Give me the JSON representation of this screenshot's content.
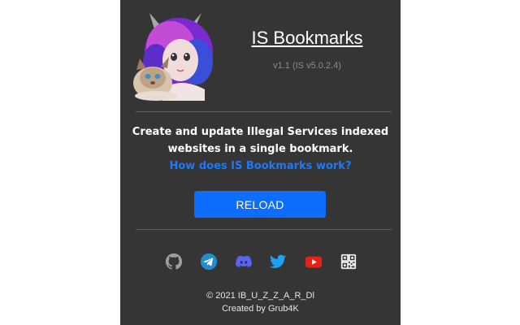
{
  "header": {
    "title": "IS Bookmarks",
    "version": "v1.1 (IS v5.0.2.4)"
  },
  "description": {
    "line1": "Create and update Illegal Services indexed",
    "line2": "websites in a single bookmark.",
    "link": "How does IS Bookmarks work?"
  },
  "actions": {
    "reload_label": "RELOAD"
  },
  "social_links": [
    {
      "icon": "github-icon"
    },
    {
      "icon": "telegram-icon"
    },
    {
      "icon": "discord-icon"
    },
    {
      "icon": "twitter-icon"
    },
    {
      "icon": "youtube-icon"
    },
    {
      "icon": "qr-code-icon"
    }
  ],
  "footer": {
    "copyright": "© 2021 IB_U_Z_Z_A_R_Dl",
    "credit": "Created by Grub4K"
  },
  "colors": {
    "background": "#353535",
    "accent": "#0d6efd",
    "link": "#1c79f7",
    "github": "#9e9e9e",
    "telegram": "#1f8fcf",
    "discord": "#5865f2",
    "twitter": "#1da1f2",
    "youtube": "#e62117"
  }
}
